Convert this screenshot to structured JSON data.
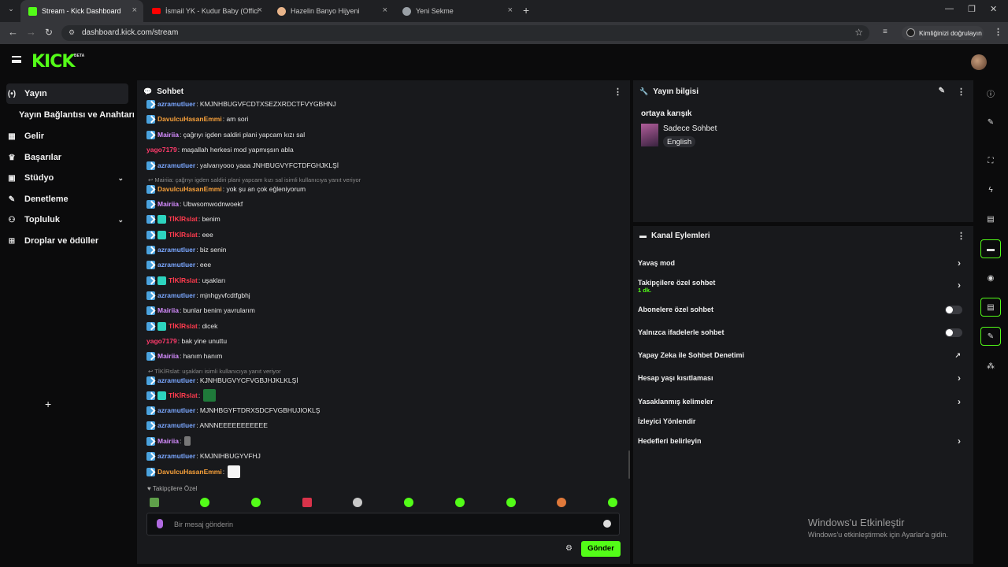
{
  "browser": {
    "tabs": [
      {
        "label": "Stream - Kick Dashboard",
        "favicon_color": "#53fc18"
      },
      {
        "label": "İsmail YK - Kudur Baby (Official",
        "favicon_color": "#ff0000"
      },
      {
        "label": "Hazelin Banyo Hijyeni",
        "favicon_color": "#e8b48a"
      },
      {
        "label": "Yeni Sekme",
        "favicon_color": "#9aa0a6"
      }
    ],
    "url": "dashboard.kick.com/stream",
    "identity_button": "Kimliğinizi doğrulayın"
  },
  "app": {
    "logo": "KICK",
    "logo_tag": "BETA"
  },
  "sidebar": {
    "items": [
      {
        "label": "Yayın",
        "icon": "broadcast-icon",
        "glyph": "(•)"
      },
      {
        "label": "Yayın Bağlantısı ve Anahtarı",
        "icon": "",
        "glyph": ""
      },
      {
        "label": "Gelir",
        "icon": "revenue-icon",
        "glyph": "▦"
      },
      {
        "label": "Başarılar",
        "icon": "trophy-icon",
        "glyph": "🏆"
      },
      {
        "label": "Stüdyo",
        "icon": "studio-icon",
        "glyph": "▣"
      },
      {
        "label": "Denetleme",
        "icon": "wrench-icon",
        "glyph": "🔧"
      },
      {
        "label": "Topluluk",
        "icon": "community-icon",
        "glyph": "👥"
      },
      {
        "label": "Droplar ve ödüller",
        "icon": "drops-icon",
        "glyph": "⬚"
      }
    ]
  },
  "chat": {
    "title": "Sohbet",
    "messages": [
      {
        "user": "azramutluer",
        "color": "#7aa7ff",
        "badge": "sub",
        "text": ": KMJNHBUGVFCDTXSEZXRDCTFVYGBHNJ"
      },
      {
        "user": "DavulcuHasanEmmi",
        "color": "#f7a03a",
        "badge": "sub",
        "text": ": am sori"
      },
      {
        "user": "Mairiia",
        "color": "#d58cff",
        "badge": "sub",
        "text": ": çağrıyı igden saldiri plani yapcam kızı sal"
      },
      {
        "user": "yago7179",
        "color": "#ff3b6b",
        "badge": "none",
        "text": ": maşallah herkesi mod yapmışsın abla"
      },
      {
        "user": "azramutluer",
        "color": "#7aa7ff",
        "badge": "sub",
        "text": ": yalvarıyooo yaaa JNHBUGVYFCTDFGHJKLŞİ"
      },
      {
        "user": "DavulcuHasanEmmi",
        "color": "#f7a03a",
        "badge": "sub",
        "text": ": yok şu an çok eğleniyorum"
      },
      {
        "user": "Mairiia",
        "color": "#d58cff",
        "badge": "sub",
        "text": ": Ubwsomwodnwoekf"
      },
      {
        "user": "TİKİRslat",
        "color": "#ff3b4e",
        "badge": "double",
        "text": ": benim"
      },
      {
        "user": "TİKİRslat",
        "color": "#ff3b4e",
        "badge": "double",
        "text": ": eee"
      },
      {
        "user": "azramutluer",
        "color": "#7aa7ff",
        "badge": "sub",
        "text": ": biz senin"
      },
      {
        "user": "azramutluer",
        "color": "#7aa7ff",
        "badge": "sub",
        "text": ": eee"
      },
      {
        "user": "TİKİRslat",
        "color": "#ff3b4e",
        "badge": "double",
        "text": ": uşakları"
      },
      {
        "user": "azramutluer",
        "color": "#7aa7ff",
        "badge": "sub",
        "text": ": mjnhgyvfcdtfgbhj"
      },
      {
        "user": "Mairiia",
        "color": "#d58cff",
        "badge": "sub",
        "text": ": bunlar benim yavrularım"
      },
      {
        "user": "TİKİRslat",
        "color": "#ff3b4e",
        "badge": "double",
        "text": ": dicek"
      },
      {
        "user": "yago7179",
        "color": "#ff3b6b",
        "badge": "none",
        "text": ": bak yine unuttu"
      },
      {
        "user": "Mairiia",
        "color": "#d58cff",
        "badge": "sub",
        "text": ": hanım hanım"
      },
      {
        "user": "azramutluer",
        "color": "#7aa7ff",
        "badge": "sub",
        "text": ": KJNHBUGVYCFVGBJHJKLKLŞİ"
      },
      {
        "user": "TİKİRslat",
        "color": "#ff3b4e",
        "badge": "double",
        "text": ":"
      },
      {
        "user": "azramutluer",
        "color": "#7aa7ff",
        "badge": "sub",
        "text": ": MJNHBGYFTDRXSDCFVGBHUJIOKLŞ"
      },
      {
        "user": "azramutluer",
        "color": "#7aa7ff",
        "badge": "sub",
        "text": ": ANNNEEEEEEEEEEE"
      },
      {
        "user": "Mairiia",
        "color": "#d58cff",
        "badge": "sub",
        "text": ":"
      },
      {
        "user": "azramutluer",
        "color": "#7aa7ff",
        "badge": "sub",
        "text": ": KMJNIHBUGYVFHJ"
      },
      {
        "user": "DavulcuHasanEmmi",
        "color": "#f7a03a",
        "badge": "sub",
        "text": ":"
      }
    ],
    "replies": [
      "Mairiia: çağrıyı igden saldiri plani yapcam kızı sal isimli kullanıcıya yanıt veriyor",
      "TİKİRslat: uşakları isimli kullanıcıya yanıt veriyor"
    ],
    "followers_only": "Takipçilere Özel",
    "input_placeholder": "Bir mesaj gönderin",
    "send_label": "Gönder"
  },
  "stream_info": {
    "title": "Yayın bilgisi",
    "stream_title": "ortaya karışık",
    "category": "Sadece Sohbet",
    "language": "English"
  },
  "channel_actions": {
    "title": "Kanal Eylemleri",
    "items": [
      {
        "label": "Yavaş mod",
        "control": "arrow"
      },
      {
        "label": "Takipçilere özel sohbet",
        "sub": "1 dk.",
        "control": "arrow"
      },
      {
        "label": "Abonelere özel sohbet",
        "control": "toggle"
      },
      {
        "label": "Yalnızca ifadelerle sohbet",
        "control": "toggle"
      },
      {
        "label": "Yapay Zeka ile Sohbet Denetimi",
        "control": "external"
      },
      {
        "label": "Hesap yaşı kısıtlaması",
        "control": "arrow"
      },
      {
        "label": "Yasaklanmış kelimeler",
        "control": "arrow"
      },
      {
        "label": "İzleyici Yönlendir",
        "control": "none"
      },
      {
        "label": "Hedefleri belirleyin",
        "control": "arrow"
      }
    ]
  },
  "watermark": {
    "title": "Windows'u Etkinleştir",
    "subtitle": "Windows'u etkinleştirmek için Ayarlar'a gidin."
  },
  "colors": {
    "accent": "#53fc18",
    "panel": "#18191c",
    "background": "#0b0b0c"
  }
}
